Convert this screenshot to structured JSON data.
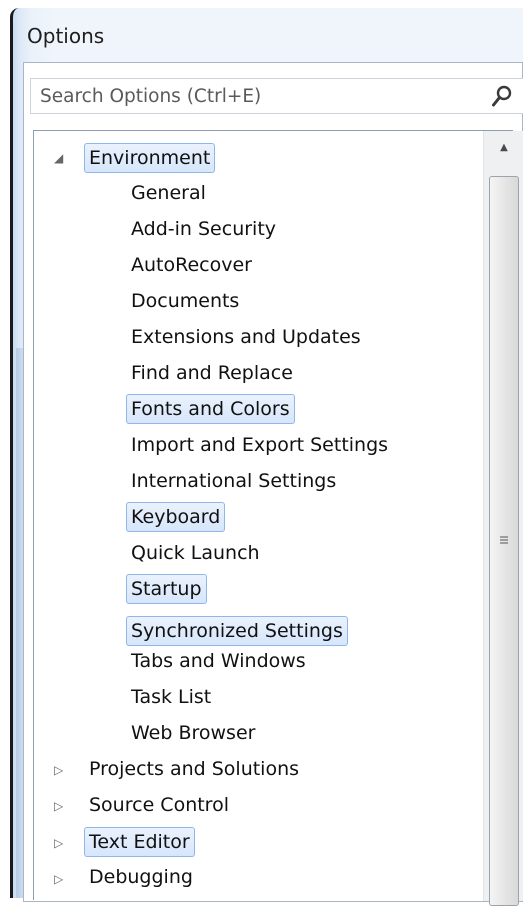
{
  "window": {
    "title": "Options"
  },
  "search": {
    "placeholder": "Search Options (Ctrl+E)",
    "value": ""
  },
  "tree": {
    "environment": {
      "label": "Environment",
      "expanded": true,
      "children": [
        "General",
        "Add-in Security",
        "AutoRecover",
        "Documents",
        "Extensions and Updates",
        "Find and Replace",
        "Fonts and Colors",
        "Import and Export Settings",
        "International Settings",
        "Keyboard",
        "Quick Launch",
        "Startup",
        "Synchronized Settings",
        "Tabs and Windows",
        "Task List",
        "Web Browser"
      ]
    },
    "top_level": [
      "Projects and Solutions",
      "Source Control",
      "Text Editor",
      "Debugging"
    ]
  },
  "colors": {
    "highlight_fill": "#d7e6fb",
    "highlight_border": "#8eb8ea"
  },
  "icons": {
    "expanded": "triangle-down-right",
    "collapsed": "triangle-right-outline",
    "search": "magnifier"
  }
}
